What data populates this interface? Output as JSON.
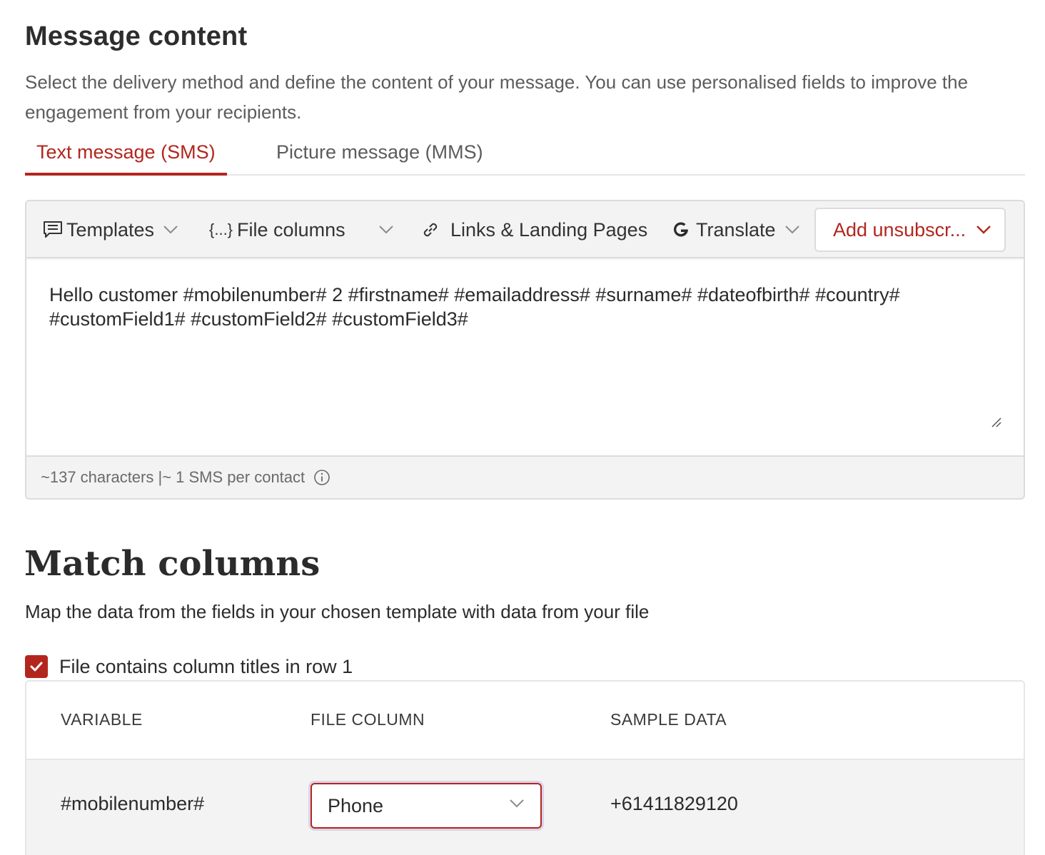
{
  "message_content": {
    "title": "Message content",
    "description": "Select the delivery method and define the content of your message. You can use personalised fields to improve the engagement from your recipients."
  },
  "tabs": [
    {
      "label": "Text message (SMS)",
      "active": true
    },
    {
      "label": "Picture message (MMS)",
      "active": false
    }
  ],
  "toolbar": {
    "templates": "Templates",
    "file_columns": "File columns",
    "file_columns_prefix": "{...}",
    "links": "Links & Landing Pages",
    "translate": "Translate",
    "add_unsubscribe": "Add unsubscr..."
  },
  "message": {
    "text": "Hello customer #mobilenumber# 2 #firstname# #emailaddress# #surname# #dateofbirth# #country# #customField1# #customField2# #customField3#"
  },
  "counter": {
    "text": "~137 characters |~ 1 SMS per contact"
  },
  "match_columns": {
    "title": "Match columns",
    "description": "Map the data from the fields in your chosen template with data from your file",
    "checkbox_label": "File contains column titles in row 1",
    "checkbox_checked": true
  },
  "table": {
    "headers": [
      "VARIABLE",
      "FILE COLUMN",
      "SAMPLE DATA"
    ],
    "rows": [
      {
        "variable": "#mobilenumber#",
        "file_column": "Phone",
        "sample": "+61411829120"
      }
    ]
  },
  "colors": {
    "accent": "#b3261e",
    "border": "#dcdcdc",
    "panel_bg": "#f3f3f3"
  },
  "icons": [
    "chat-template-icon",
    "chevron-down-icon",
    "braces-icon",
    "link-icon",
    "google-translate-icon",
    "resize-grip-icon",
    "info-icon",
    "checkmark-icon"
  ]
}
